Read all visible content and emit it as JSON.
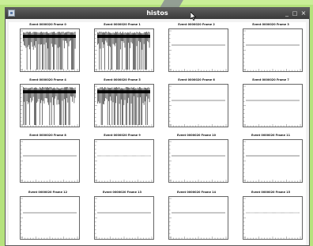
{
  "window": {
    "title": "histos",
    "controls": {
      "minimize": "_",
      "maximize": "□",
      "close": "×"
    }
  },
  "panels": [
    {
      "title": "Event 0000020 Frame 0",
      "pattern": "spikes"
    },
    {
      "title": "Event 0000020 Frame 1",
      "pattern": "spikes"
    },
    {
      "title": "Event 0000020 Frame 2",
      "pattern": "flat"
    },
    {
      "title": "Event 0000020 Frame 3",
      "pattern": "flat"
    },
    {
      "title": "Event 0000020 Frame 4",
      "pattern": "spikes"
    },
    {
      "title": "Event 0000020 Frame 5",
      "pattern": "spikes"
    },
    {
      "title": "Event 0000020 Frame 6",
      "pattern": "flat"
    },
    {
      "title": "Event 0000020 Frame 7",
      "pattern": "flat"
    },
    {
      "title": "Event 0000020 Frame 8",
      "pattern": "flat"
    },
    {
      "title": "Event 0000020 Frame 9",
      "pattern": "flat-dotted"
    },
    {
      "title": "Event 0000020 Frame 10",
      "pattern": "flat"
    },
    {
      "title": "Event 0000020 Frame 11",
      "pattern": "flat-gray"
    },
    {
      "title": "Event 0000020 Frame 12",
      "pattern": "flat"
    },
    {
      "title": "Event 0000020 Frame 13",
      "pattern": "flat"
    },
    {
      "title": "Event 0000020 Frame 14",
      "pattern": "flat"
    },
    {
      "title": "Event 0000020 Frame 15",
      "pattern": "flat-dotted"
    }
  ],
  "colors": {
    "background": "#b5e27d",
    "titlebar": "#4a4a4a",
    "trace": "#000000"
  },
  "icons": {
    "app": "app-icon",
    "cursor": "cursor-arrow-icon"
  }
}
